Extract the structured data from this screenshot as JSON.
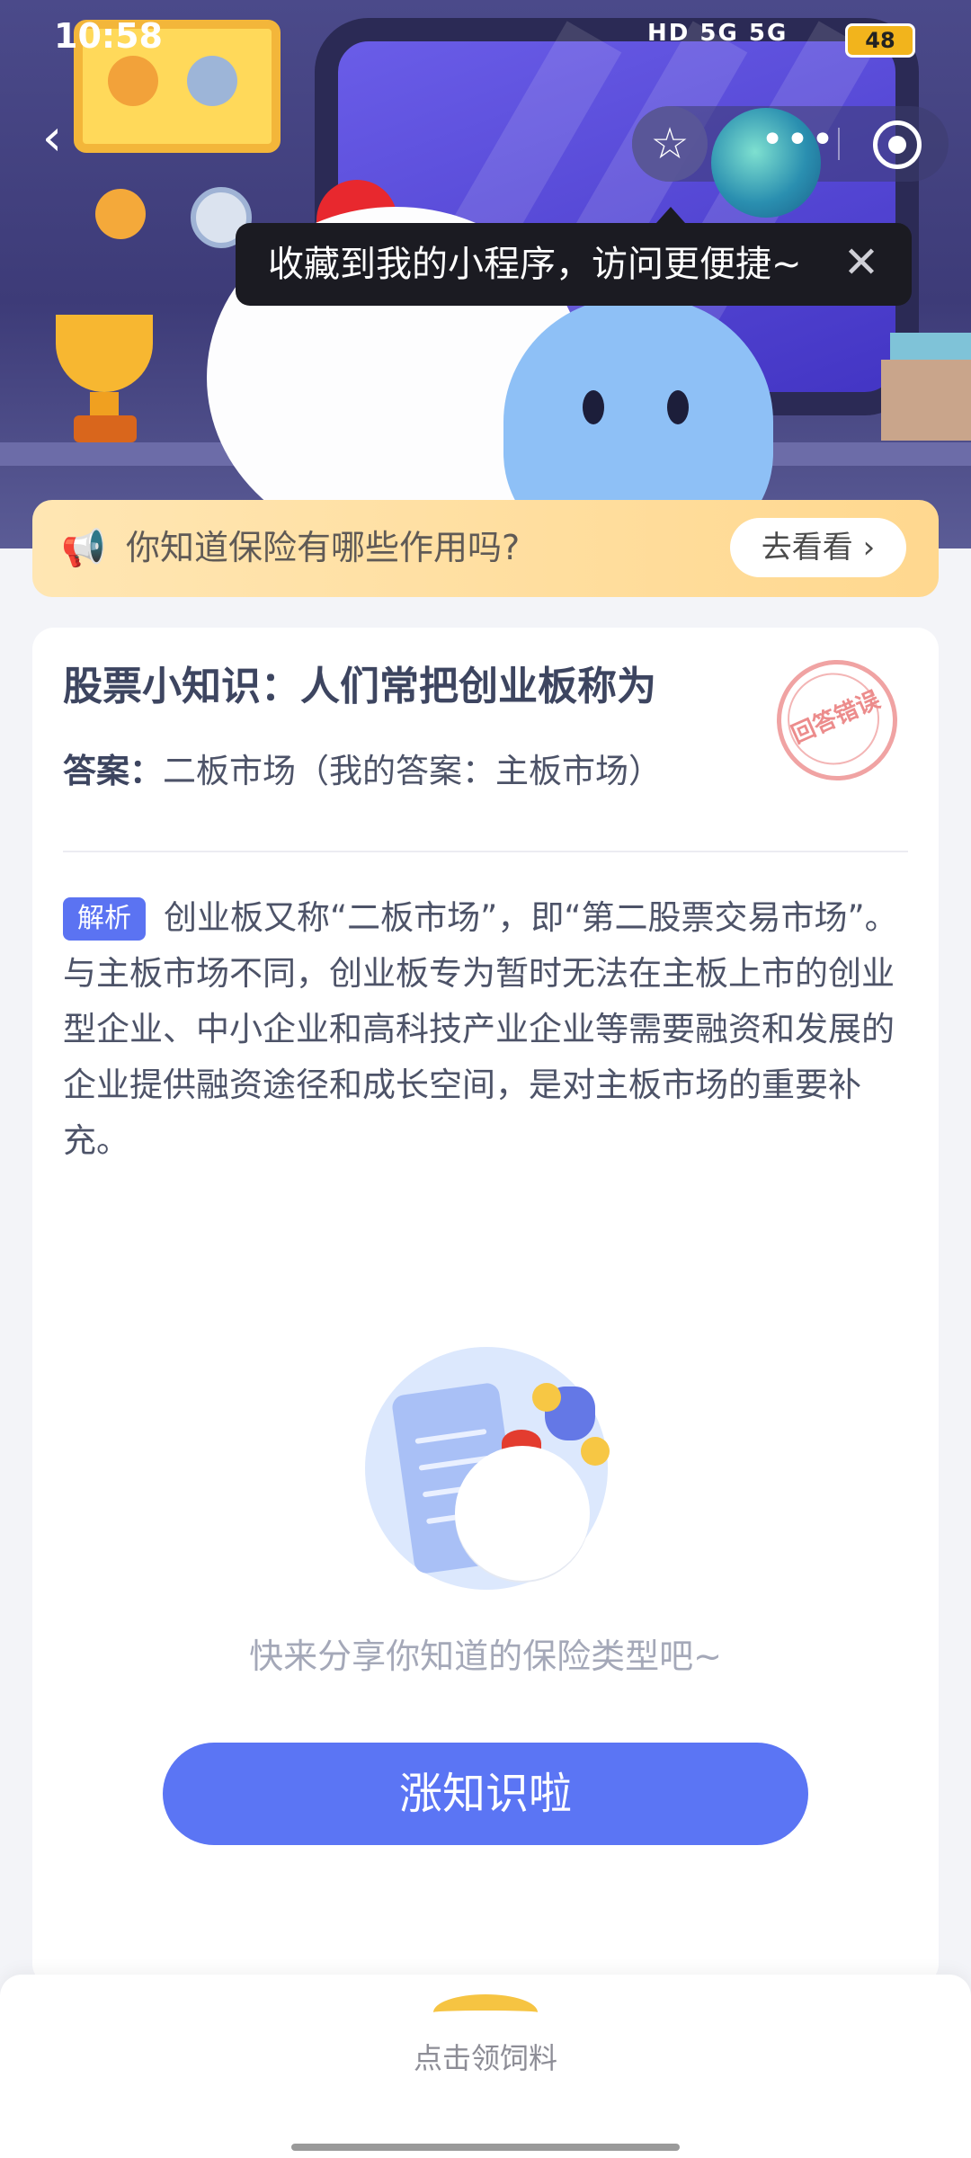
{
  "status_bar": {
    "time": "10:58",
    "signal_text": "HD 5G 5G",
    "battery": "48"
  },
  "nav": {
    "tooltip": "收藏到我的小程序，访问更便捷~",
    "close_glyph": "✕",
    "back_glyph": "‹",
    "star_glyph": "☆",
    "more_glyph": "•••"
  },
  "notice": {
    "text": "你知道保险有哪些作用吗?",
    "button": "去看看 ›",
    "horn_glyph": "📢"
  },
  "question": {
    "title": "股票小知识：人们常把创业板称为",
    "answer_label": "答案：",
    "answer_text": "二板市场（我的答案：主板市场）",
    "stamp": "回答错误",
    "analysis_tag": "解析",
    "analysis_text": "创业板又称“二板市场”，即“第二股票交易市场”。与主板市场不同，创业板专为暂时无法在主板上市的创业型企业、中小企业和高科技产业企业等需要融资和发展的企业提供融资途径和成长空间，是对主板市场的重要补充。"
  },
  "illustration": {
    "coin_glyph": "¥"
  },
  "share": {
    "text": "快来分享你知道的保险类型吧~",
    "button": "涨知识啦"
  },
  "bottom_bar": {
    "label": "点击领饲料"
  },
  "colors": {
    "accent": "#5b75f4",
    "notice_bg": "#ffdf9e",
    "stamp": "#ec8c8c"
  }
}
